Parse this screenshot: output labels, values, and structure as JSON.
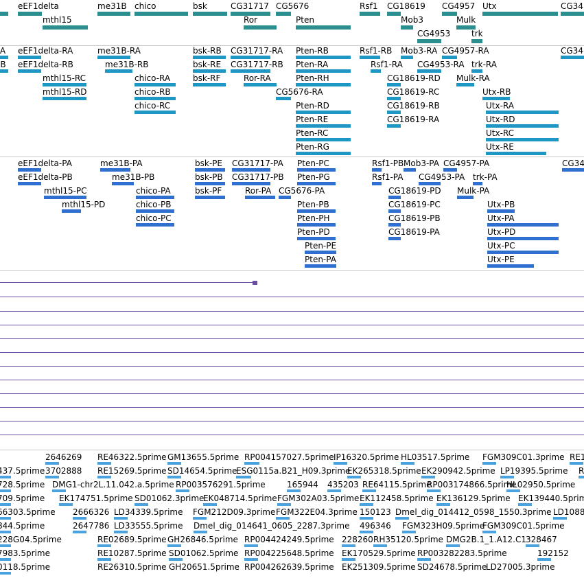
{
  "gene_track": {
    "color": "#2b8f8f",
    "features": [
      {
        "label": "eEF1delta"
      },
      {
        "label": "me31B"
      },
      {
        "label": "chico"
      },
      {
        "label": "bsk"
      },
      {
        "label": "CG31717"
      },
      {
        "label": "CG5676"
      },
      {
        "label": "Rsf1"
      },
      {
        "label": "CG18619"
      },
      {
        "label": "CG4957"
      },
      {
        "label": "Utx"
      },
      {
        "label": "CG34"
      },
      {
        "label": "mthl15"
      },
      {
        "label": "Ror"
      },
      {
        "label": "Pten"
      },
      {
        "label": "Mob3"
      },
      {
        "label": "Mulk"
      },
      {
        "label": "CG4953"
      },
      {
        "label": "trk"
      }
    ]
  },
  "transcript_track": {
    "color": "#1f97c4",
    "features": [
      {
        "label": "RA"
      },
      {
        "label": "RB"
      },
      {
        "label": "eEF1delta-RA"
      },
      {
        "label": "eEF1delta-RB"
      },
      {
        "label": "me31B-RA"
      },
      {
        "label": "me31B-RB"
      },
      {
        "label": "bsk-RB"
      },
      {
        "label": "bsk-RE"
      },
      {
        "label": "bsk-RF"
      },
      {
        "label": "CG31717-RA"
      },
      {
        "label": "CG31717-RB"
      },
      {
        "label": "Pten-RB"
      },
      {
        "label": "Pten-RA"
      },
      {
        "label": "Pten-RH"
      },
      {
        "label": "Rsf1-RB"
      },
      {
        "label": "Rsf1-RA"
      },
      {
        "label": "Mob3-RA"
      },
      {
        "label": "CG4957-RA"
      },
      {
        "label": "CG4953-RA"
      },
      {
        "label": "trk-RA"
      },
      {
        "label": "CG34"
      },
      {
        "label": "mthl15-RC"
      },
      {
        "label": "mthl15-RD"
      },
      {
        "label": "chico-RA"
      },
      {
        "label": "chico-RB"
      },
      {
        "label": "chico-RC"
      },
      {
        "label": "Ror-RA"
      },
      {
        "label": "CG5676-RA"
      },
      {
        "label": "Pten-RD"
      },
      {
        "label": "Pten-RE"
      },
      {
        "label": "Pten-RC"
      },
      {
        "label": "Pten-RG"
      },
      {
        "label": "CG18619-RD"
      },
      {
        "label": "CG18619-RC"
      },
      {
        "label": "CG18619-RB"
      },
      {
        "label": "CG18619-RA"
      },
      {
        "label": "Mulk-RA"
      },
      {
        "label": "Utx-RB"
      },
      {
        "label": "Utx-RA"
      },
      {
        "label": "Utx-RD"
      },
      {
        "label": "Utx-RC"
      },
      {
        "label": "Utx-RE"
      }
    ]
  },
  "protein_track": {
    "color": "#2f6fd0",
    "features": [
      {
        "label": "eEF1delta-PA"
      },
      {
        "label": "eEF1delta-PB"
      },
      {
        "label": "me31B-PA"
      },
      {
        "label": "me31B-PB"
      },
      {
        "label": "bsk-PE"
      },
      {
        "label": "bsk-PB"
      },
      {
        "label": "bsk-PF"
      },
      {
        "label": "CG31717-PA"
      },
      {
        "label": "CG31717-PB"
      },
      {
        "label": "Pten-PC"
      },
      {
        "label": "Pten-PG"
      },
      {
        "label": "Rsf1-PB"
      },
      {
        "label": "Mob3-PA"
      },
      {
        "label": "CG4957-PA"
      },
      {
        "label": "CG34"
      },
      {
        "label": "Rsf1-PA"
      },
      {
        "label": "CG4953-PA"
      },
      {
        "label": "trk-PA"
      },
      {
        "label": "mthl15-PC"
      },
      {
        "label": "mthl15-PD"
      },
      {
        "label": "chico-PA"
      },
      {
        "label": "chico-PB"
      },
      {
        "label": "chico-PC"
      },
      {
        "label": "Ror-PA"
      },
      {
        "label": "CG5676-PA"
      },
      {
        "label": "CG18619-PD"
      },
      {
        "label": "CG18619-PC"
      },
      {
        "label": "CG18619-PB"
      },
      {
        "label": "CG18619-PA"
      },
      {
        "label": "Mulk-PA"
      },
      {
        "label": "Pten-PB"
      },
      {
        "label": "Pten-PH"
      },
      {
        "label": "Pten-PD"
      },
      {
        "label": "Pten-PE"
      },
      {
        "label": "Pten-PA"
      },
      {
        "label": "Utx-PB"
      },
      {
        "label": "Utx-PA"
      },
      {
        "label": "Utx-PD"
      },
      {
        "label": "Utx-PC"
      },
      {
        "label": "Utx-PE"
      }
    ]
  },
  "wiggle_track": {
    "color": "#6a4fa0"
  },
  "est_track": {
    "color": "#4aa3df",
    "rows": [
      [
        "2646269",
        "RE46322.5prime",
        "GM13655.5prime",
        "RP004157027.5prime",
        "IP16320.5prime",
        "HL03517.5prime",
        "FGM309C01.3prime",
        "RE1"
      ],
      [
        "437.5prime",
        "3702888",
        "RE15269.5prime",
        "SD14654.5prime",
        "ESG0115a.B21_H09.3prime",
        "EK265318.5prime",
        "EK290942.5prime",
        "LP19395.5prime",
        "R"
      ],
      [
        "728.5prime",
        "DMG1-chr2L.11.042.a.5prime",
        "RP003576291.5prime",
        "165944",
        "435203",
        "RE64115.5prime",
        "RP003174866.5prime",
        "HL02950.5prime"
      ],
      [
        "709.5prime",
        "EK174751.5prime",
        "SD01062.3prime",
        "EK048714.5prime",
        "FGM302A03.5prime",
        "EK112458.5prime",
        "EK136129.5prime",
        "EK139440.5prime"
      ],
      [
        "66303.5prime",
        "2666326",
        "LD34339.5prime",
        "FGM212D09.3prime",
        "FGM322E04.3prime",
        "150123",
        "Dmel_dig_014412_0598_1550.3prime",
        "LD1088"
      ],
      [
        "844.5prime",
        "2647786",
        "LD33555.5prime",
        "Dmel_dig_014641_0605_2287.3prime",
        "496346",
        "FGM323H09.5prime",
        "FGM309C01.5prime"
      ],
      [
        "228G04.5prime",
        "RE02689.5prime",
        "GH26846.5prime",
        "RP004424249.5prime",
        "228260",
        "RH35120.5prime",
        "DMG2B.1_1.A12.C1",
        "328467"
      ],
      [
        "7983.5prime",
        "RE10287.5prime",
        "SD01062.5prime",
        "RP004225648.5prime",
        "EK170529.5prime",
        "RP003282283.5prime",
        "192152"
      ],
      [
        "0118.5prime",
        "RE26310.5prime",
        "GH20651.5prime",
        "RP004262639.5prime",
        "EK251309.5prime",
        "SD24678.5prime",
        "LD27005.3prime"
      ]
    ]
  }
}
